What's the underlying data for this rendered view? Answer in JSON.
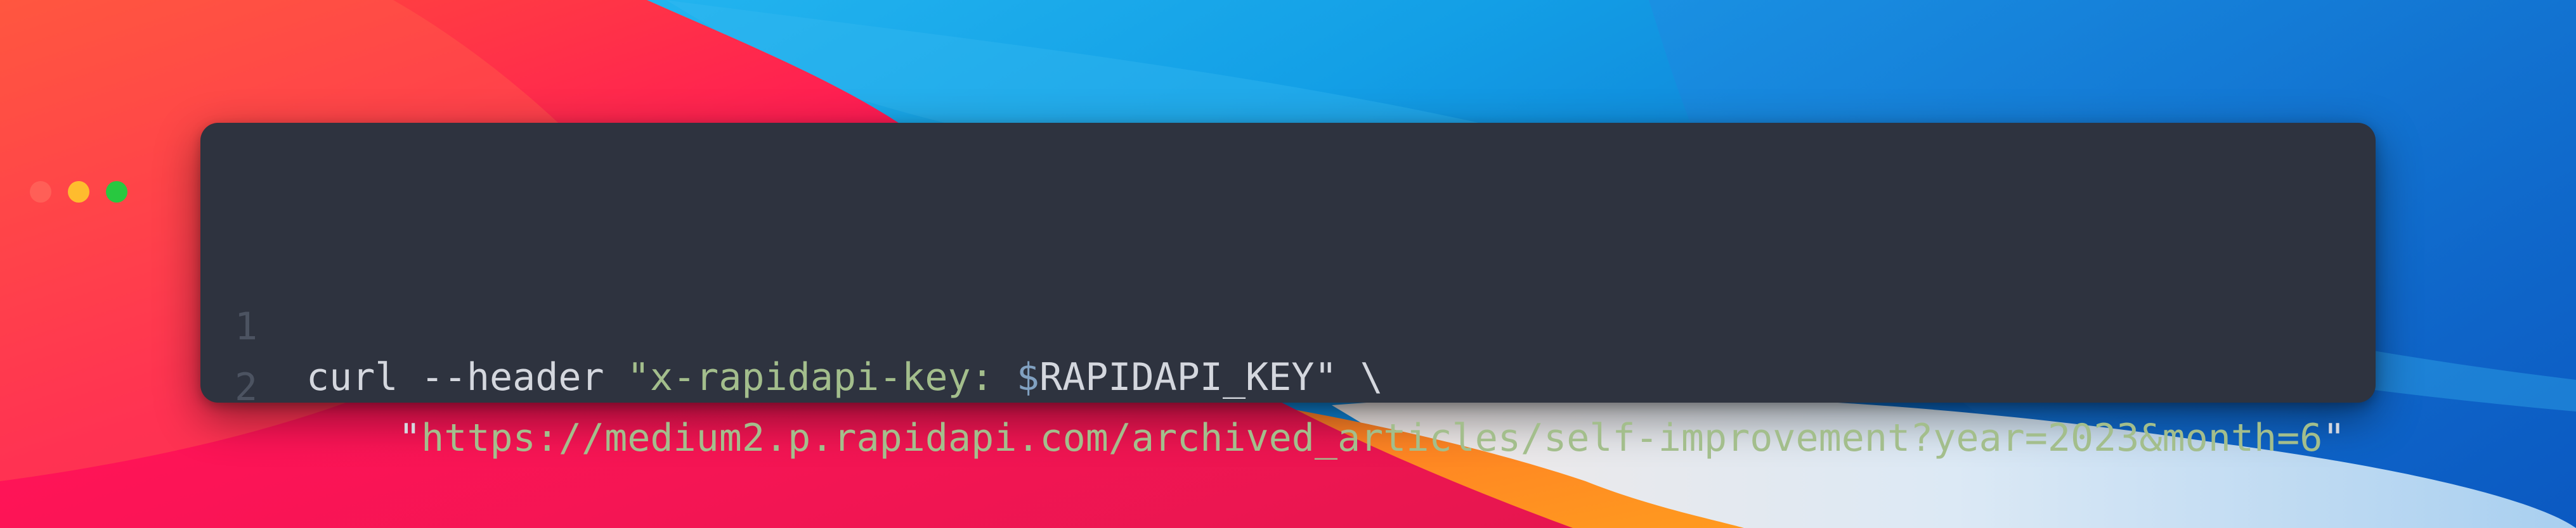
{
  "theme": {
    "window_background": "#2e333f",
    "close_color": "#ff5f57",
    "minimize_color": "#febc2e",
    "maximize_color": "#28c840",
    "string_color": "#a3be8c",
    "plain_color": "#d4d7de",
    "variable_sigil_color": "#81a1c1",
    "line_number_color": "#4c5361"
  },
  "window_controls": [
    "close-dot",
    "minimize-dot",
    "maximize-dot"
  ],
  "code": {
    "lines": [
      {
        "number": "1",
        "tokens": {
          "cmd": "curl --header ",
          "str_open": "\"x-rapidapi-key: ",
          "sigil": "$",
          "var": "RAPIDAPI_KEY",
          "str_close": "\"",
          "continuation": " \\"
        }
      },
      {
        "number": "2",
        "tokens": {
          "quote_open": "\"",
          "url": "https://medium2.p.rapidapi.com/archived_articles/self-improvement?year=2023&month=6",
          "quote_close": "\""
        }
      }
    ]
  }
}
